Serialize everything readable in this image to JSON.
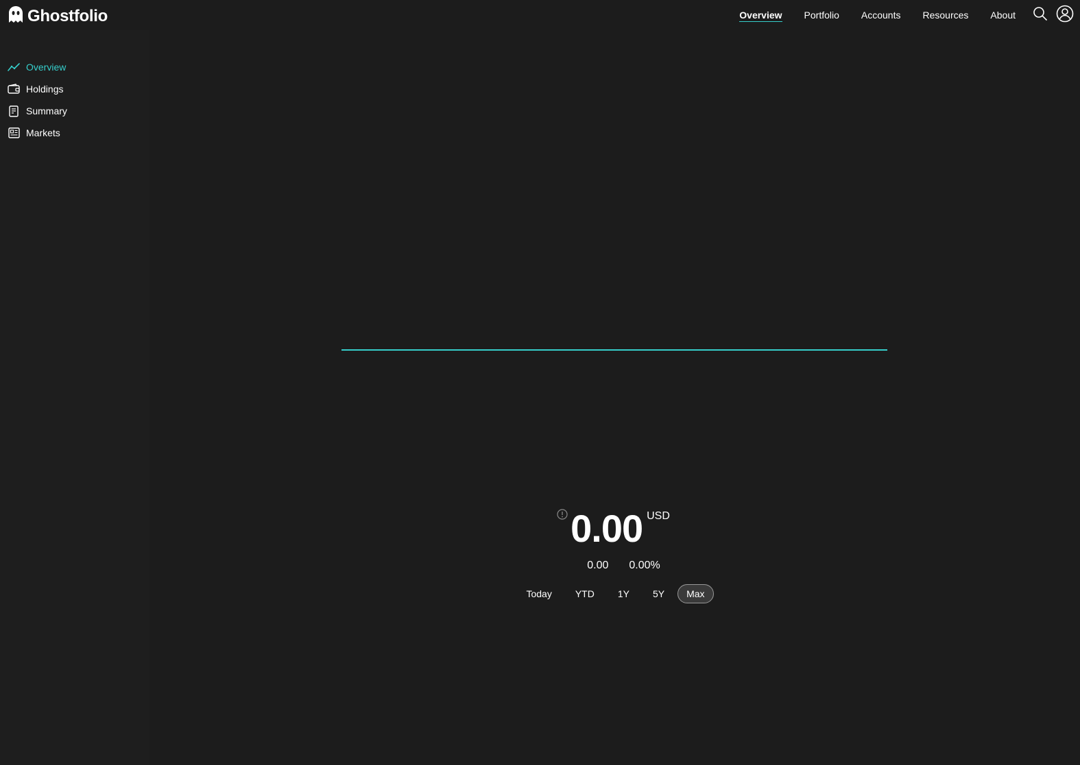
{
  "app": {
    "name": "Ghostfolio"
  },
  "nav": {
    "items": [
      {
        "label": "Overview",
        "active": true
      },
      {
        "label": "Portfolio",
        "active": false
      },
      {
        "label": "Accounts",
        "active": false
      },
      {
        "label": "Resources",
        "active": false
      },
      {
        "label": "About",
        "active": false
      }
    ],
    "search_icon": "search-icon",
    "user_icon": "user-circle-icon"
  },
  "sidebar": {
    "items": [
      {
        "label": "Overview",
        "icon": "trend-line-icon",
        "active": true
      },
      {
        "label": "Holdings",
        "icon": "wallet-icon",
        "active": false
      },
      {
        "label": "Summary",
        "icon": "document-icon",
        "active": false
      },
      {
        "label": "Markets",
        "icon": "newspaper-icon",
        "active": false
      }
    ]
  },
  "performance": {
    "value": "0.00",
    "currency": "USD",
    "absolute_change": "0.00",
    "relative_change": "0.00%"
  },
  "date_ranges": {
    "options": [
      "Today",
      "YTD",
      "1Y",
      "5Y",
      "Max"
    ],
    "selected": "Max"
  },
  "colors": {
    "accent": "#36cfcc",
    "background": "#1c1c1c",
    "sidebar": "#1e1e1e"
  }
}
